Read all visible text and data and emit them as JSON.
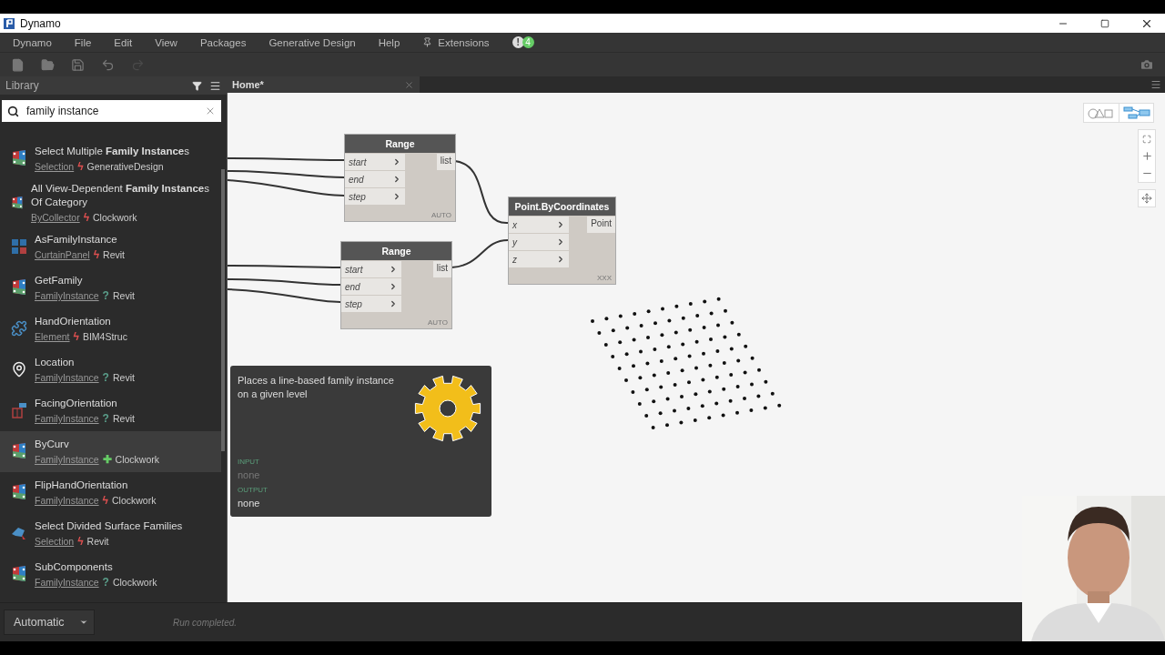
{
  "title_bar": {
    "title": "Dynamo"
  },
  "menu": {
    "items": [
      "Dynamo",
      "File",
      "Edit",
      "View",
      "Packages",
      "Generative Design",
      "Help"
    ],
    "extensions": "Extensions",
    "alert": "!",
    "count": "4"
  },
  "library": {
    "title": "Library",
    "search": {
      "value": "family instance"
    },
    "items": [
      {
        "kind": "node",
        "name": "Select Multiple **Family Instance**s",
        "category": "Selection",
        "status": "ϟ",
        "color": "#e05050",
        "package": "GenerativeDesign",
        "selected": false
      },
      {
        "kind": "node",
        "name": "All View-Dependent **Family Instance**s Of Category",
        "category": "ByCollector",
        "status": "ϟ",
        "color": "#e05050",
        "package": "Clockwork",
        "selected": false
      },
      {
        "kind": "panel",
        "name": "AsFamilyInstance",
        "category": "CurtainPanel",
        "status": "ϟ",
        "color": "#e05050",
        "package": "Revit",
        "selected": false
      },
      {
        "kind": "node",
        "name": "GetFamily",
        "category": "FamilyInstance",
        "status": "?",
        "color": "#5a9e8a",
        "package": "Revit",
        "selected": false
      },
      {
        "kind": "puzzle",
        "name": "HandOrientation",
        "category": "Element",
        "status": "ϟ",
        "color": "#e05050",
        "package": "BIM4Struc",
        "selected": false
      },
      {
        "kind": "pin",
        "name": "Location",
        "category": "FamilyInstance",
        "status": "?",
        "color": "#5a9e8a",
        "package": "Revit",
        "selected": false
      },
      {
        "kind": "facing",
        "name": "FacingOrientation",
        "category": "FamilyInstance",
        "status": "?",
        "color": "#5a9e8a",
        "package": "Revit",
        "selected": false
      },
      {
        "kind": "node",
        "name": "ByCurv",
        "category": "FamilyInstance",
        "status": "✚",
        "color": "#66cc66",
        "package": "Clockwork",
        "selected": true
      },
      {
        "kind": "node",
        "name": "FlipHandOrientation",
        "category": "FamilyInstance",
        "status": "ϟ",
        "color": "#e05050",
        "package": "Clockwork",
        "selected": false
      },
      {
        "kind": "surface",
        "name": "Select Divided Surface Families",
        "category": "Selection",
        "status": "ϟ",
        "color": "#e05050",
        "package": "Revit",
        "selected": false
      },
      {
        "kind": "node",
        "name": "SubComponents",
        "category": "FamilyInstance",
        "status": "?",
        "color": "#5a9e8a",
        "package": "Clockwork",
        "selected": false
      }
    ]
  },
  "tabs": [
    {
      "label": "Home*",
      "selected": true
    }
  ],
  "nodes": [
    {
      "title": "Range",
      "inputs": [
        "start",
        "end",
        "step"
      ],
      "output": "list",
      "lacing": "AUTO"
    },
    {
      "title": "Range",
      "inputs": [
        "start",
        "end",
        "step"
      ],
      "output": "list",
      "lacing": "AUTO"
    },
    {
      "title": "Point.ByCoordinates",
      "inputs": [
        "x",
        "y",
        "z"
      ],
      "output": "Point",
      "lacing": "XXX"
    }
  ],
  "tooltip": {
    "description": "Places a line-based family instance on a given level",
    "input_label": "INPUT",
    "input_value": "none",
    "output_label": "OUTPUT",
    "output_value": "none"
  },
  "run_bar": {
    "mode": "Automatic",
    "status": "Run completed."
  }
}
